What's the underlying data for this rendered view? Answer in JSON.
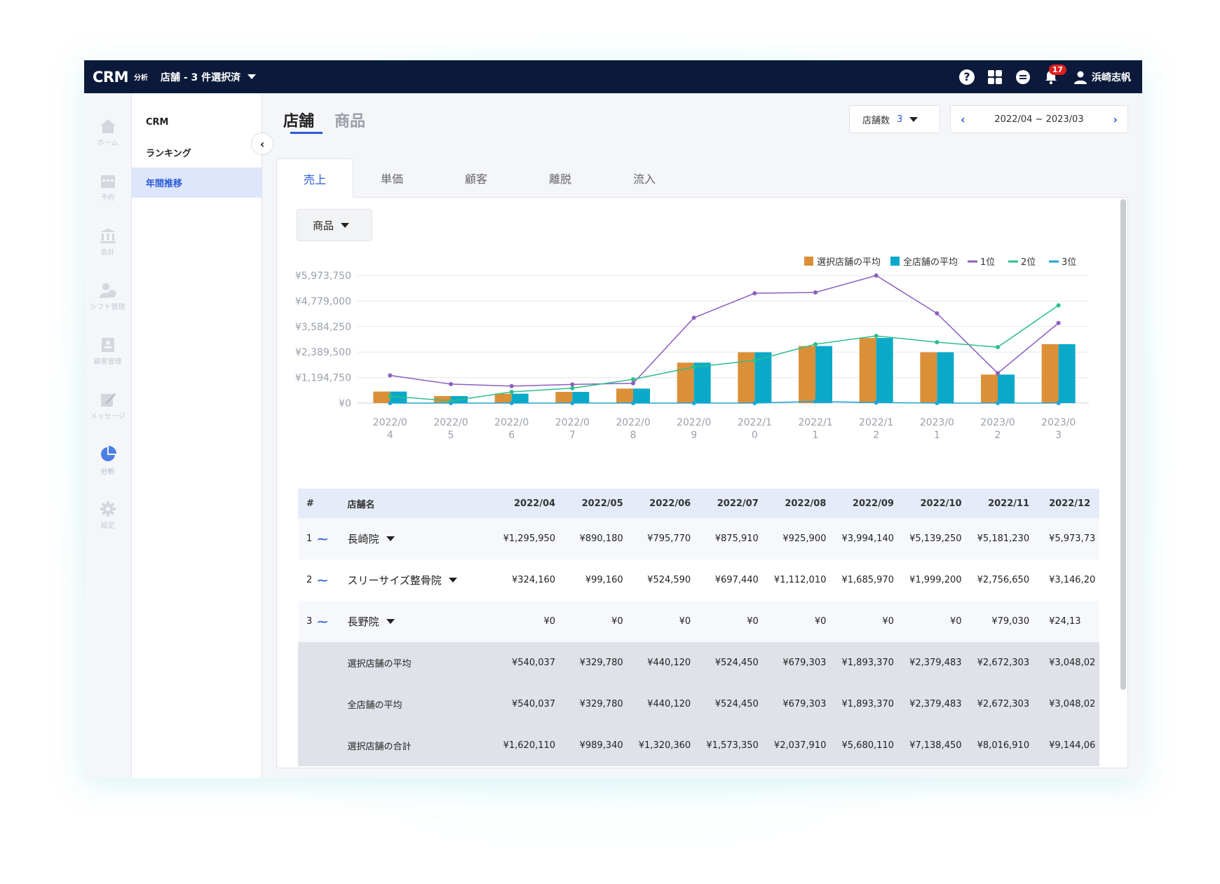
{
  "topbar": {
    "logo": "CRM",
    "logo_sub": "分析",
    "store_select": "店舗 - 3 件選択済",
    "notification_count": "17",
    "user_name": "浜崎志帆",
    "help_label": "?"
  },
  "rail": {
    "items": [
      {
        "label": "ホーム",
        "icon": "home-icon"
      },
      {
        "label": "予約",
        "icon": "calendar-icon"
      },
      {
        "label": "会計",
        "icon": "bank-icon"
      },
      {
        "label": "シフト管理",
        "icon": "shift-icon"
      },
      {
        "label": "顧客管理",
        "icon": "customer-icon"
      },
      {
        "label": "メッセージ",
        "icon": "message-icon"
      },
      {
        "label": "分析",
        "icon": "pie-chart-icon"
      },
      {
        "label": "設定",
        "icon": "gear-icon"
      }
    ]
  },
  "subnav": {
    "items": [
      "CRM",
      "ランキング",
      "年間推移"
    ],
    "active": "年間推移"
  },
  "page_tabs": [
    "店舗",
    "商品"
  ],
  "controls": {
    "count_label": "店舗数",
    "count_value": "3",
    "date_range": "2022/04 ~ 2023/03",
    "prev": "‹",
    "next": "›"
  },
  "sub_tabs": [
    "売上",
    "単価",
    "顧客",
    "離脱",
    "流入"
  ],
  "product_select": "商品",
  "chart_data": {
    "type": "bar",
    "categories": [
      "2022/04",
      "2022/05",
      "2022/06",
      "2022/07",
      "2022/08",
      "2022/09",
      "2022/10",
      "2022/11",
      "2022/12",
      "2023/01",
      "2023/02",
      "2023/03"
    ],
    "y_ticks": [
      "¥5,973,750",
      "¥4,779,000",
      "¥3,584,250",
      "¥2,389,500",
      "¥1,194,750",
      "¥0"
    ],
    "ylim": [
      0,
      5973750
    ],
    "series": [
      {
        "name": "選択店舗の平均",
        "kind": "bar",
        "color": "#db9038",
        "values": [
          540037,
          329780,
          440120,
          524450,
          679303,
          1893370,
          2379483,
          2672303,
          3048020,
          2379483,
          1335000,
          2760000
        ]
      },
      {
        "name": "全店舗の平均",
        "kind": "bar",
        "color": "#0aa9c9",
        "values": [
          540037,
          329780,
          440120,
          524450,
          679303,
          1893370,
          2379483,
          2672303,
          3048020,
          2379483,
          1335000,
          2760000
        ]
      },
      {
        "name": "1位",
        "kind": "line",
        "color": "#8b5fbf",
        "values": [
          1295950,
          890180,
          795770,
          875910,
          925900,
          3994140,
          5139250,
          5181230,
          5973730,
          4200000,
          1400000,
          3750000
        ]
      },
      {
        "name": "2位",
        "kind": "line",
        "color": "#2cbf8a",
        "values": [
          324160,
          99160,
          524590,
          697440,
          1112010,
          1685970,
          1999200,
          2756650,
          3146200,
          2850000,
          2620000,
          4580000
        ]
      },
      {
        "name": "3位",
        "kind": "line",
        "color": "#1fa6d6",
        "values": [
          0,
          0,
          0,
          0,
          0,
          0,
          0,
          79030,
          24130,
          0,
          0,
          0
        ]
      }
    ],
    "legend_position": "top-right",
    "grid": true
  },
  "table": {
    "headers": [
      "#",
      "店舗名",
      "2022/04",
      "2022/05",
      "2022/06",
      "2022/07",
      "2022/08",
      "2022/09",
      "2022/10",
      "2022/11",
      "2022/12"
    ],
    "rows": [
      {
        "rank": "1",
        "name": "長崎院",
        "values": [
          "¥1,295,950",
          "¥890,180",
          "¥795,770",
          "¥875,910",
          "¥925,900",
          "¥3,994,140",
          "¥5,139,250",
          "¥5,181,230",
          "¥5,973,73"
        ]
      },
      {
        "rank": "2",
        "name": "スリーサイズ整骨院",
        "values": [
          "¥324,160",
          "¥99,160",
          "¥524,590",
          "¥697,440",
          "¥1,112,010",
          "¥1,685,970",
          "¥1,999,200",
          "¥2,756,650",
          "¥3,146,20"
        ]
      },
      {
        "rank": "3",
        "name": "長野院",
        "values": [
          "¥0",
          "¥0",
          "¥0",
          "¥0",
          "¥0",
          "¥0",
          "¥0",
          "¥79,030",
          "¥24,13"
        ]
      }
    ],
    "summary": [
      {
        "name": "選択店舗の平均",
        "values": [
          "¥540,037",
          "¥329,780",
          "¥440,120",
          "¥524,450",
          "¥679,303",
          "¥1,893,370",
          "¥2,379,483",
          "¥2,672,303",
          "¥3,048,02"
        ]
      },
      {
        "name": "全店舗の平均",
        "values": [
          "¥540,037",
          "¥329,780",
          "¥440,120",
          "¥524,450",
          "¥679,303",
          "¥1,893,370",
          "¥2,379,483",
          "¥2,672,303",
          "¥3,048,02"
        ]
      },
      {
        "name": "選択店舗の合計",
        "values": [
          "¥1,620,110",
          "¥989,340",
          "¥1,320,360",
          "¥1,573,350",
          "¥2,037,910",
          "¥5,680,110",
          "¥7,138,450",
          "¥8,016,910",
          "¥9,144,06"
        ]
      }
    ]
  }
}
